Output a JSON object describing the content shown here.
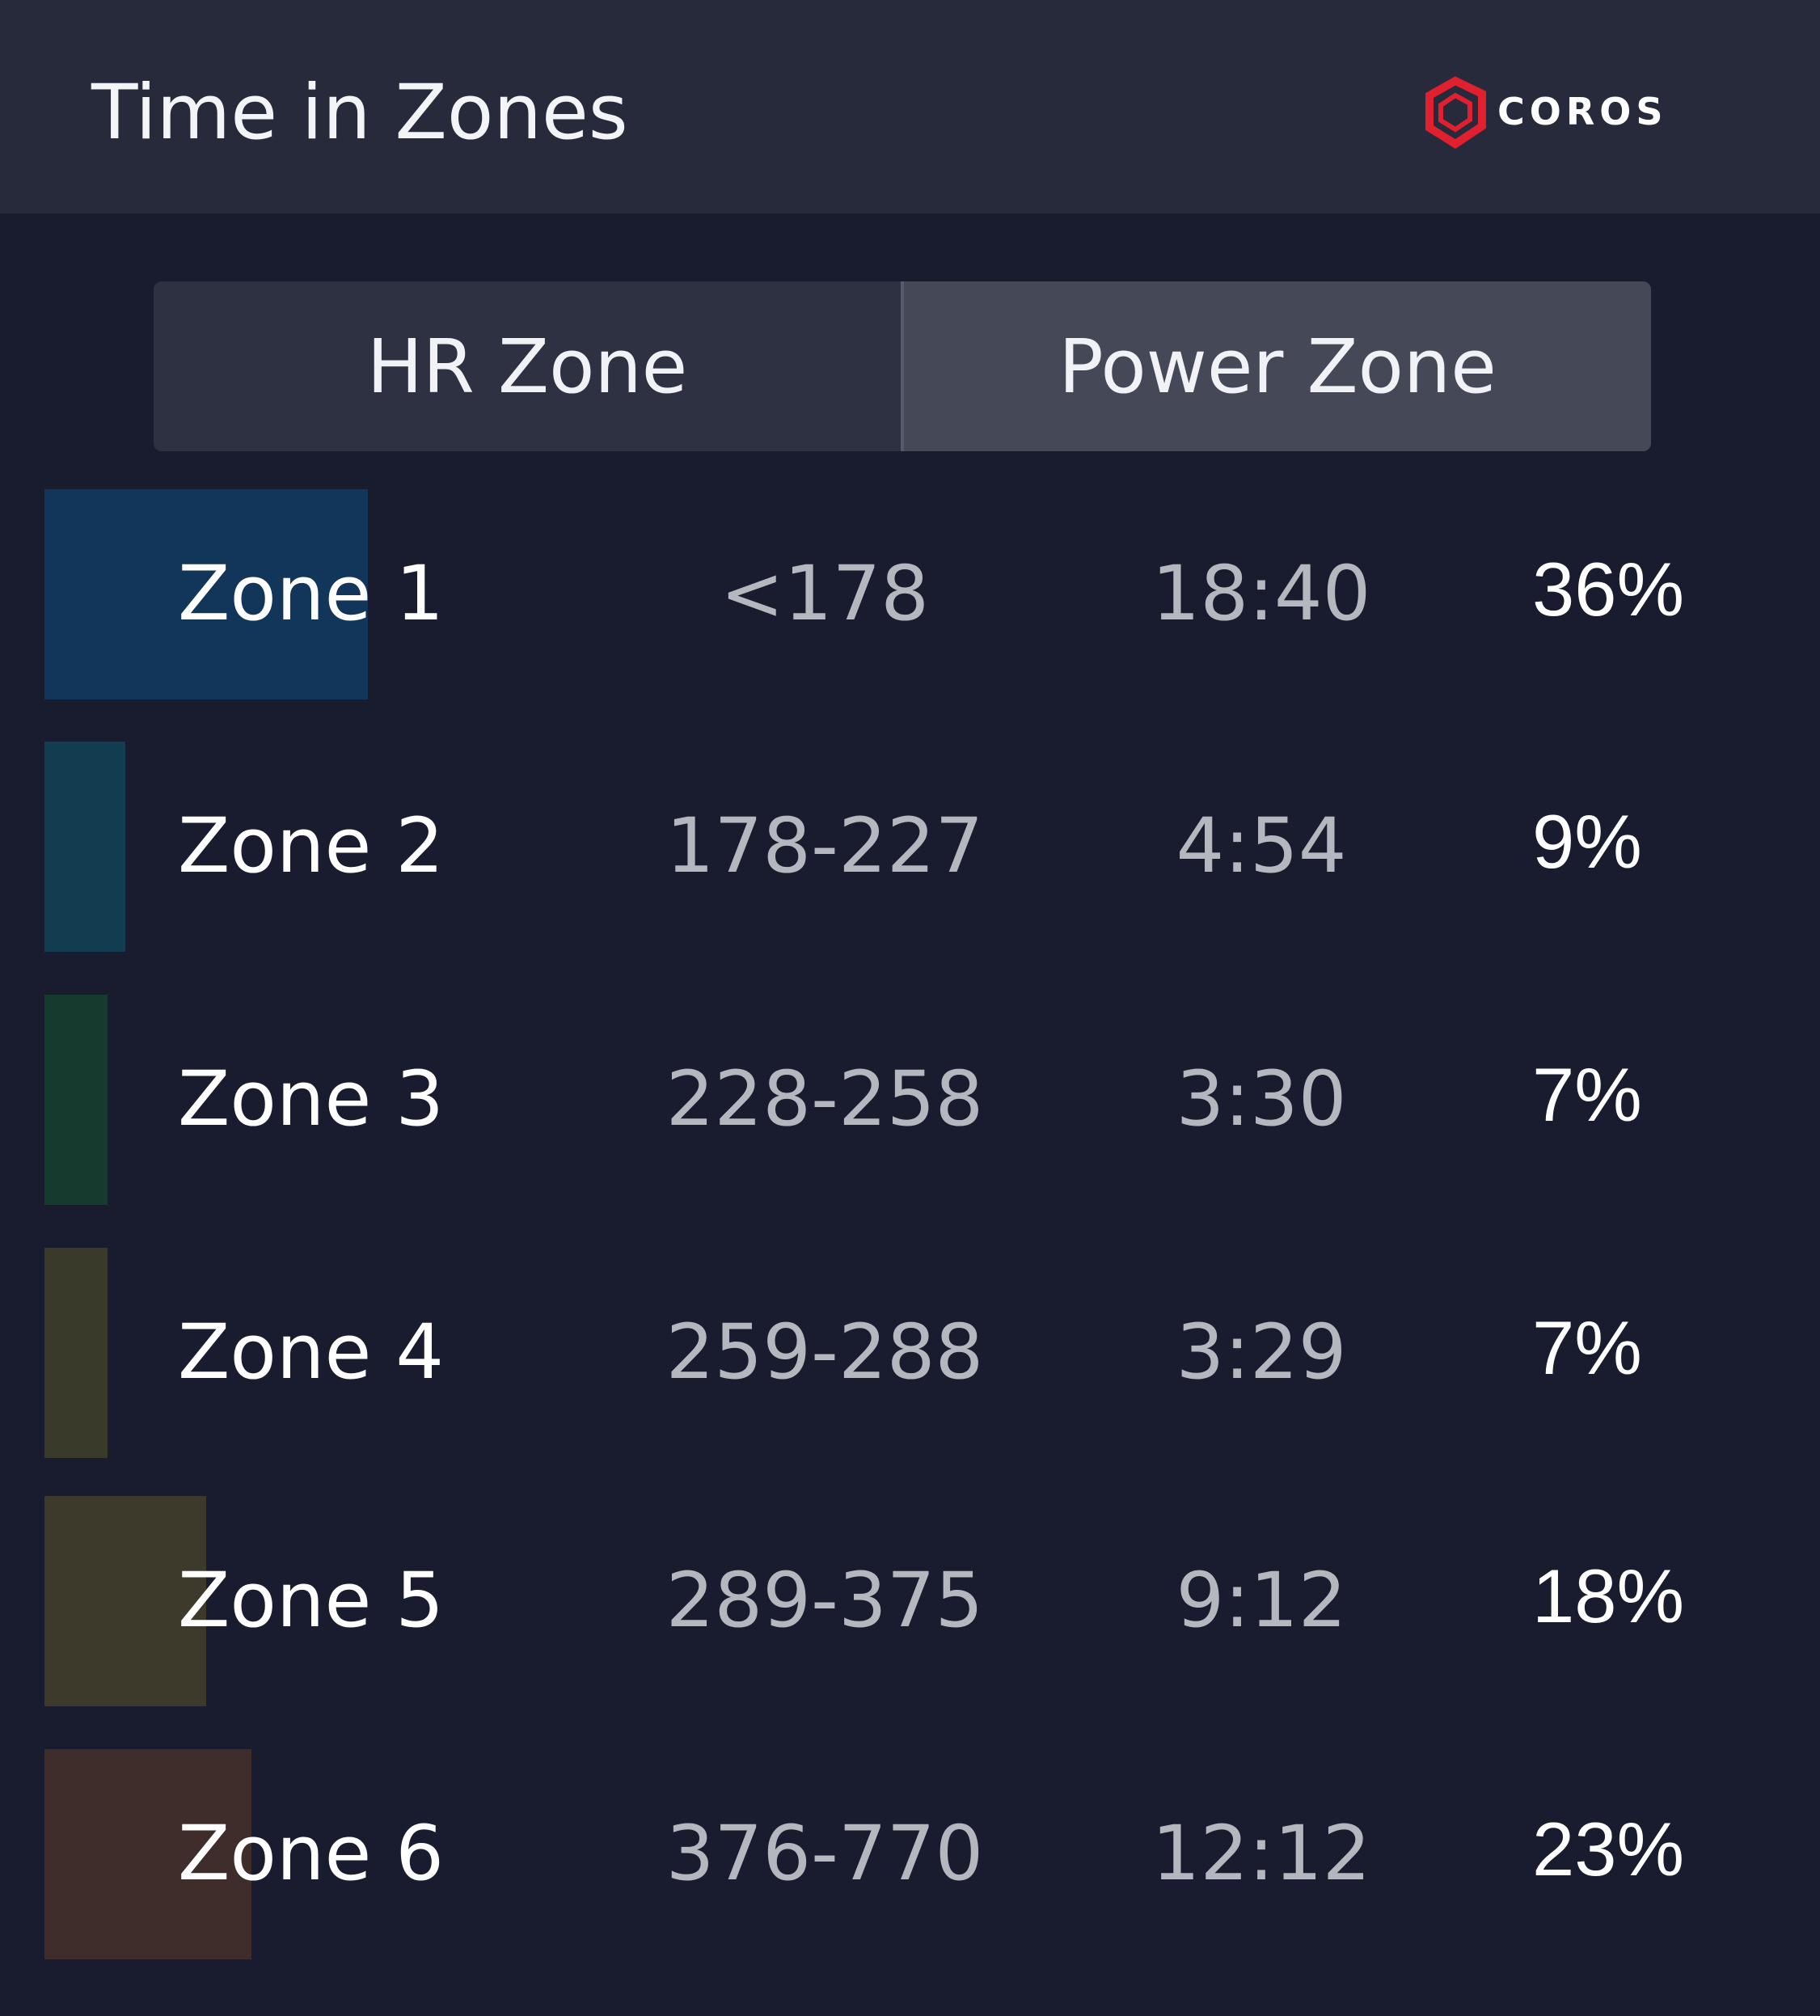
{
  "header": {
    "title": "Time in Zones",
    "logo_text": "COROS",
    "logo_color": "#e0202e"
  },
  "tabs": [
    {
      "label": "HR Zone",
      "active": false
    },
    {
      "label": "Power Zone",
      "active": true
    }
  ],
  "zones": [
    {
      "name": "Zone 1",
      "range": "<178",
      "time": "18:40",
      "percent": "36%",
      "share": 0.36,
      "color": "#12355a"
    },
    {
      "name": "Zone 2",
      "range": "178-227",
      "time": "4:54",
      "percent": "9%",
      "share": 0.09,
      "color": "#123d50"
    },
    {
      "name": "Zone 3",
      "range": "228-258",
      "time": "3:30",
      "percent": "7%",
      "share": 0.07,
      "color": "#173a2e"
    },
    {
      "name": "Zone 4",
      "range": "259-288",
      "time": "3:29",
      "percent": "7%",
      "share": 0.07,
      "color": "#3a3a2a"
    },
    {
      "name": "Zone 5",
      "range": "289-375",
      "time": "9:12",
      "percent": "18%",
      "share": 0.18,
      "color": "#3d3a2c"
    },
    {
      "name": "Zone 6",
      "range": "376-770",
      "time": "12:12",
      "percent": "23%",
      "share": 0.23,
      "color": "#3f2d2b"
    }
  ]
}
